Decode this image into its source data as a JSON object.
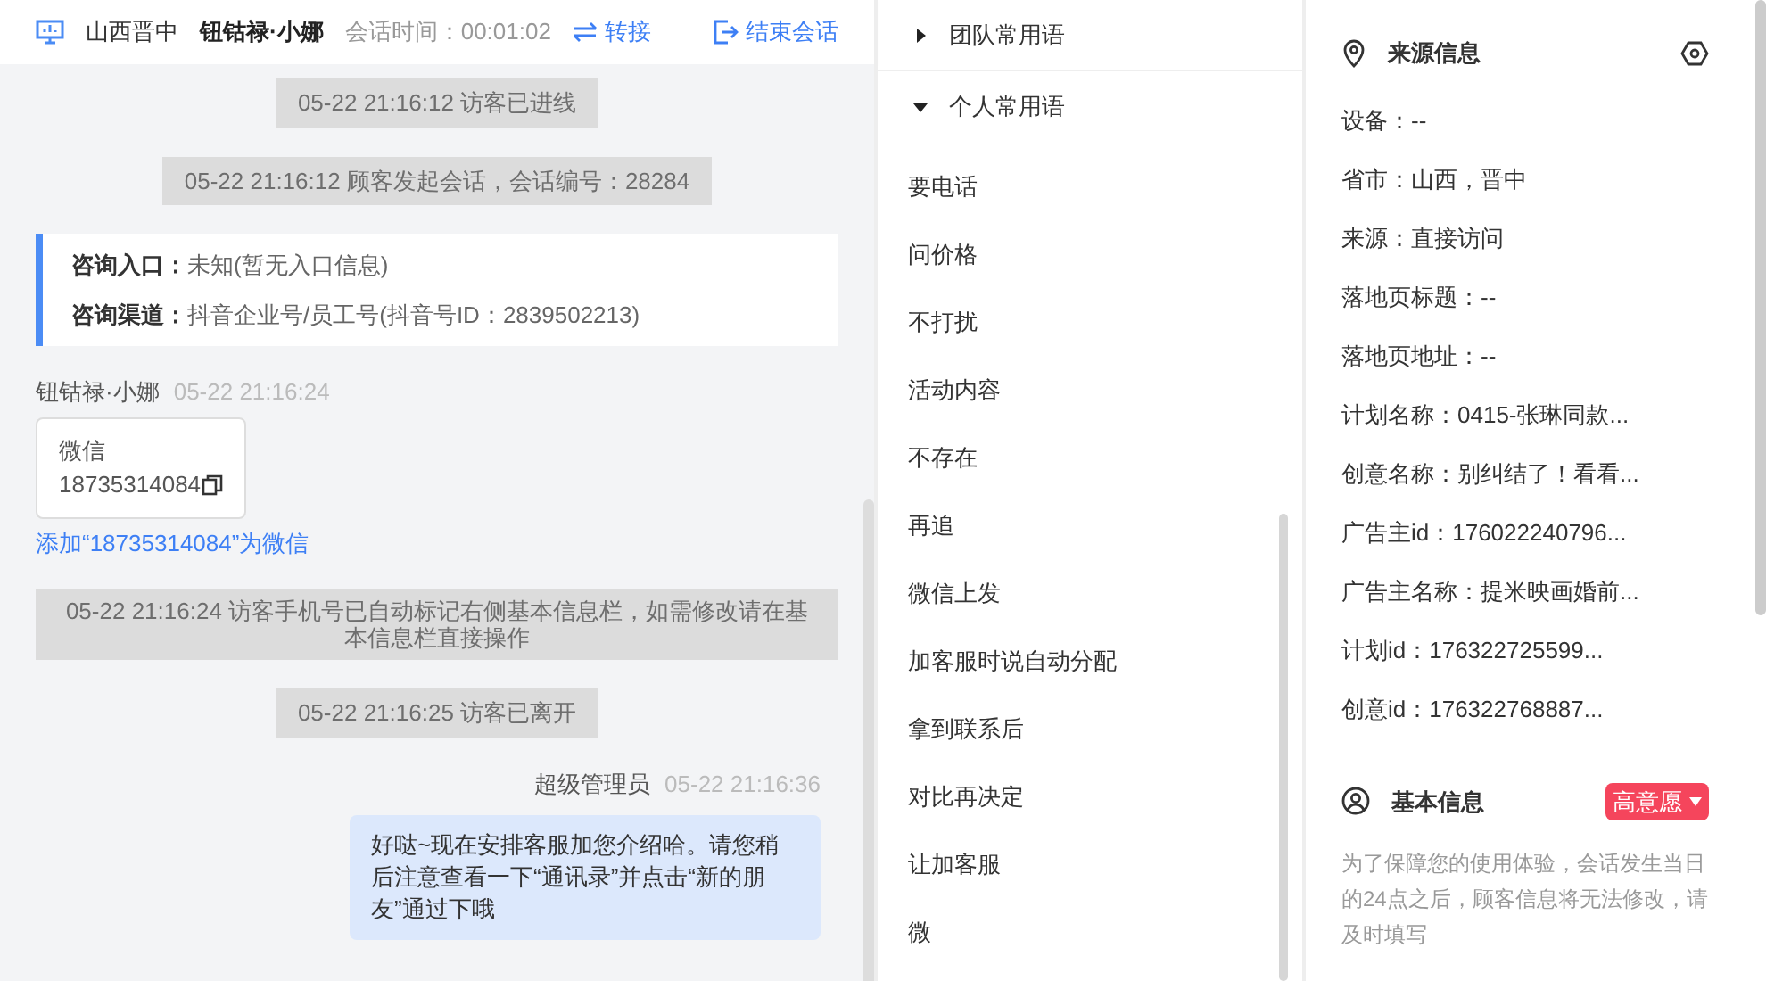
{
  "header": {
    "location": "山西晋中",
    "agent": "钮钴禄·小娜",
    "session_time": "会话时间：00:01:02",
    "transfer": "转接",
    "end": "结束会话"
  },
  "messages": [
    {
      "kind": "system",
      "text": "05-22 21:16:12 访客已进线"
    },
    {
      "kind": "system",
      "text": "05-22 21:16:12 顾客发起会话，会话编号：28284"
    },
    {
      "kind": "info",
      "rows": [
        {
          "label": "咨询入口：",
          "value": "未知(暂无入口信息)"
        },
        {
          "label": "咨询渠道：",
          "value": "抖音企业号/员工号(抖音号ID：2839502213)"
        }
      ]
    },
    {
      "kind": "card",
      "sender": "钮钴禄·小娜",
      "time": "05-22 21:16:24",
      "title": "微信",
      "number": "18735314084",
      "link": "添加“18735314084”为微信"
    },
    {
      "kind": "notice",
      "text": "05-22 21:16:24 访客手机号已自动标记右侧基本信息栏，如需修改请在基本信息栏直接操作"
    },
    {
      "kind": "system",
      "text": "05-22 21:16:25 访客已离开"
    },
    {
      "kind": "reply",
      "sender": "超级管理员",
      "time": "05-22 21:16:36",
      "text": "好哒~现在安排客服加您介绍哈。请您稍后注意查看一下“通讯录”并点击“新的朋友”通过下哦"
    }
  ],
  "phrases": {
    "groups": [
      {
        "label": "团队常用语",
        "expanded": false
      },
      {
        "label": "个人常用语",
        "expanded": true
      }
    ],
    "items": [
      "要电话",
      "问价格",
      "不打扰",
      "活动内容",
      "不存在",
      "再追",
      "微信上发",
      "加客服时说自动分配",
      "拿到联系后",
      "对比再决定",
      "让加客服",
      "微"
    ]
  },
  "source": {
    "title": "来源信息",
    "rows": [
      "设备：--",
      "省市：山西，晋中",
      "来源：直接访问",
      "落地页标题：--",
      "落地页地址：--",
      "计划名称：0415-张琳同款...",
      "创意名称：别纠结了！看看...",
      "广告主id：176022240796...",
      "广告主名称：提米映画婚前...",
      "计划id：176322725599...",
      "创意id：176322768887..."
    ]
  },
  "basic": {
    "title": "基本信息",
    "tag": "高意愿",
    "note": "为了保障您的使用体验，会话发生当日的24点之后，顾客信息将无法修改，请及时填写"
  }
}
